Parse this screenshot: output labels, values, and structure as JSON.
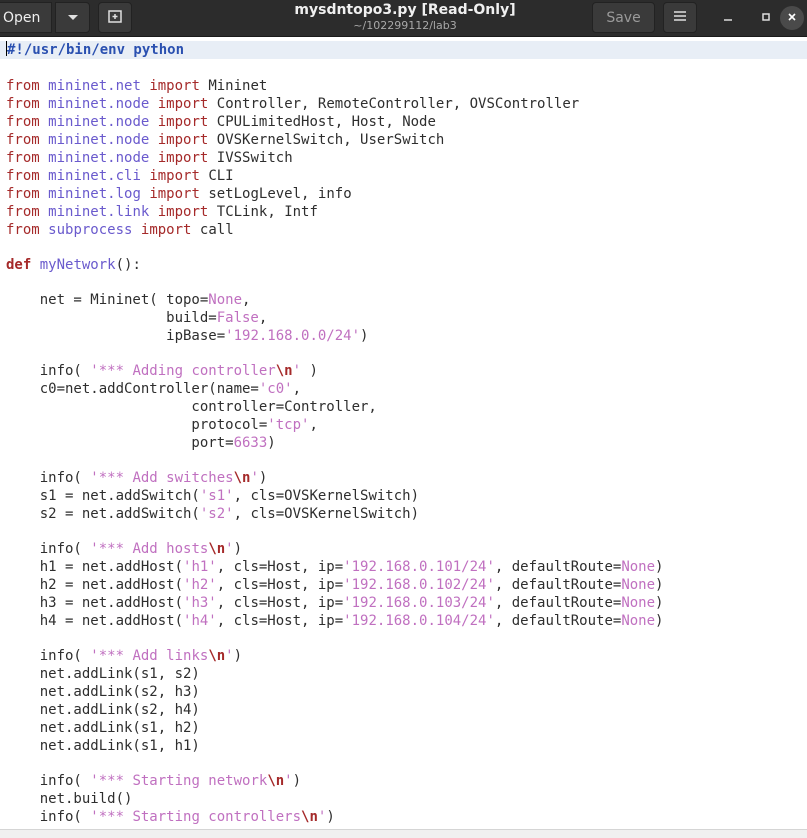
{
  "header": {
    "open_label": "Open",
    "title": "mysdntopo3.py [Read-Only]",
    "subtitle": "~/102299112/lab3",
    "save_label": "Save"
  },
  "code": {
    "l1": "#!/usr/bin/env python",
    "import_from": "from",
    "import_kw": "import",
    "m1": "mininet.net",
    "i1": "Mininet",
    "m2": "mininet.node",
    "i2": "Controller, RemoteController, OVSController",
    "m3": "mininet.node",
    "i3": "CPULimitedHost, Host, Node",
    "m4": "mininet.node",
    "i4": "OVSKernelSwitch, UserSwitch",
    "m5": "mininet.node",
    "i5": "IVSSwitch",
    "m6": "mininet.cli",
    "i6": "CLI",
    "m7": "mininet.log",
    "i7": "setLogLevel, info",
    "m8": "mininet.link",
    "i8": "TCLink, Intf",
    "m9": "subprocess",
    "i9": "call",
    "def_kw": "def",
    "fn_name": "myNetwork",
    "fn_tail": "():",
    "net_a": "    net = Mininet( topo=",
    "none": "None",
    "false": "False",
    "build_a": "                   build=",
    "ipbase_a": "                   ipBase=",
    "ipbase_s": "'192.168.0.0/24'",
    "close_paren": ")",
    "comma": ",",
    "nl": "\\n",
    "info_a": "    info( ",
    "info_s1": "'*** Adding controller",
    "q": "'",
    "info_t1": " )",
    "c0_a": "    c0=net.addController(name=",
    "c0_s": "'c0'",
    "ctrl_a": "                      controller=Controller,",
    "proto_a": "                      protocol=",
    "proto_s": "'tcp'",
    "port_a": "                      port=",
    "port_v": "6633",
    "info_s2": "'*** Add switches",
    "s1_a": "    s1 = net.addSwitch(",
    "s1_s": "'s1'",
    "s_tail": ", cls=OVSKernelSwitch)",
    "s2_a": "    s2 = net.addSwitch(",
    "s2_s": "'s2'",
    "info_s3": "'*** Add hosts",
    "h1_a": "    h1 = net.addHost(",
    "h1_s": "'h1'",
    "h1_ip": "'192.168.0.101/24'",
    "h2_a": "    h2 = net.addHost(",
    "h2_s": "'h2'",
    "h2_ip": "'192.168.0.102/24'",
    "h3_a": "    h3 = net.addHost(",
    "h3_s": "'h3'",
    "h3_ip": "'192.168.0.103/24'",
    "h4_a": "    h4 = net.addHost(",
    "h4_s": "'h4'",
    "h4_ip": "'192.168.0.104/24'",
    "h_mid": ", cls=Host, ip=",
    "h_dr": ", defaultRoute=",
    "info_s4": "'*** Add links",
    "link1": "    net.addLink(s1, s2)",
    "link2": "    net.addLink(s2, h3)",
    "link3": "    net.addLink(s2, h4)",
    "link4": "    net.addLink(s1, h2)",
    "link5": "    net.addLink(s1, h1)",
    "info_s5": "'*** Starting network",
    "build_call": "    net.build()",
    "info_s6": "'*** Starting controllers"
  },
  "icons": {
    "dropdown": "chevron-down-icon",
    "newtab": "new-tab-icon",
    "menu": "hamburger-menu-icon",
    "minimize": "minimize-icon",
    "maximize": "maximize-icon",
    "close": "close-icon"
  }
}
